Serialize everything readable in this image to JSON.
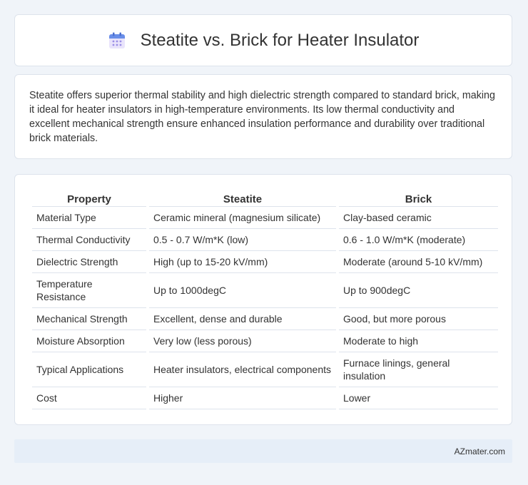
{
  "header": {
    "title": "Steatite vs. Brick for Heater Insulator",
    "icon": "calendar-icon",
    "icon_color": "#5b7fd6"
  },
  "summary": {
    "text": "Steatite offers superior thermal stability and high dielectric strength compared to standard brick, making it ideal for heater insulators in high-temperature environments. Its low thermal conductivity and excellent mechanical strength ensure enhanced insulation performance and durability over traditional brick materials."
  },
  "table": {
    "headers": [
      "Property",
      "Steatite",
      "Brick"
    ],
    "rows": [
      [
        "Material Type",
        "Ceramic mineral (magnesium silicate)",
        "Clay-based ceramic"
      ],
      [
        "Thermal Conductivity",
        "0.5 - 0.7 W/m*K (low)",
        "0.6 - 1.0 W/m*K (moderate)"
      ],
      [
        "Dielectric Strength",
        "High (up to 15-20 kV/mm)",
        "Moderate (around 5-10 kV/mm)"
      ],
      [
        "Temperature Resistance",
        "Up to 1000degC",
        "Up to 900degC"
      ],
      [
        "Mechanical Strength",
        "Excellent, dense and durable",
        "Good, but more porous"
      ],
      [
        "Moisture Absorption",
        "Very low (less porous)",
        "Moderate to high"
      ],
      [
        "Typical Applications",
        "Heater insulators, electrical components",
        "Furnace linings, general insulation"
      ],
      [
        "Cost",
        "Higher",
        "Lower"
      ]
    ]
  },
  "footer": {
    "text": "AZmater.com"
  }
}
